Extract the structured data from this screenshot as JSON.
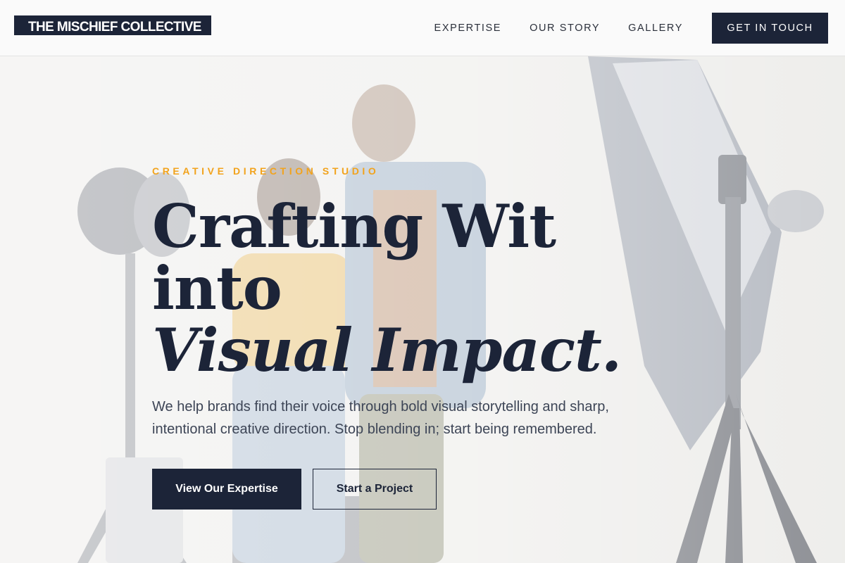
{
  "brand": {
    "name": "THE MISCHIEF COLLECTIVE"
  },
  "nav": {
    "links": [
      {
        "label": "EXPERTISE"
      },
      {
        "label": "OUR STORY"
      },
      {
        "label": "GALLERY"
      }
    ],
    "cta_label": "GET IN TOUCH"
  },
  "hero": {
    "eyebrow": "CREATIVE DIRECTION STUDIO",
    "headline_line1": "Crafting Wit into",
    "headline_line2": "Visual Impact.",
    "subtext": "We help brands find their voice through bold visual storytelling and sharp, intentional creative direction. Stop blending in; start being remembered.",
    "primary_button": "View Our Expertise",
    "secondary_button": "Start a Project"
  },
  "colors": {
    "navy": "#1c2438",
    "accent": "#f2a31c",
    "body_text": "#3d4556",
    "background": "#eeeeec"
  },
  "background_image": {
    "subject": "photo-studio-two-people-with-camera-and-lights"
  }
}
